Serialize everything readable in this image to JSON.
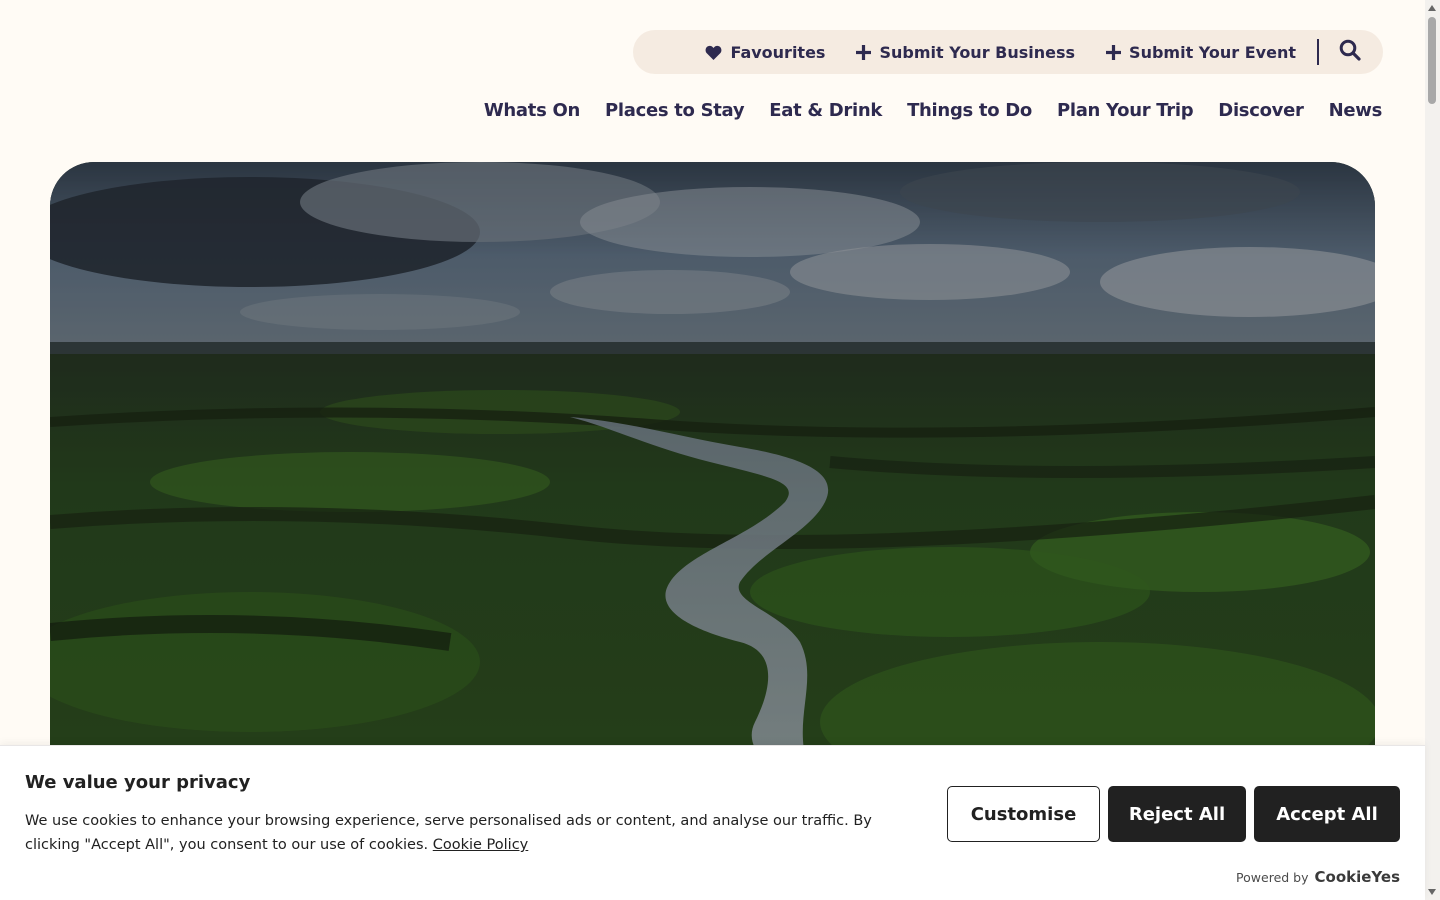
{
  "utility_nav": {
    "favourites": {
      "label": "Favourites",
      "icon": "heart-icon"
    },
    "submit_business": {
      "label": "Submit Your Business",
      "icon": "plus-icon"
    },
    "submit_event": {
      "label": "Submit Your Event",
      "icon": "plus-icon"
    },
    "search": {
      "icon": "search-icon"
    }
  },
  "main_nav": {
    "items": [
      {
        "label": "Whats On"
      },
      {
        "label": "Places to Stay"
      },
      {
        "label": "Eat & Drink"
      },
      {
        "label": "Things to Do"
      },
      {
        "label": "Plan Your Trip"
      },
      {
        "label": "Discover"
      },
      {
        "label": "News"
      }
    ]
  },
  "hero": {
    "image_subject": "aerial-river-landscape"
  },
  "cookie_banner": {
    "title": "We value your privacy",
    "body": "We use cookies to enhance your browsing experience, serve personalised ads or content, and analyse our traffic. By clicking \"Accept All\", you consent to our use of cookies.",
    "policy_link": "Cookie Policy",
    "buttons": {
      "customise": "Customise",
      "reject": "Reject All",
      "accept": "Accept All"
    },
    "powered_by": "Powered by",
    "brand": "CookieYes"
  },
  "colors": {
    "page_bg": "#fffbf5",
    "nav_text": "#2e2a4f",
    "utility_bar_bg": "#f5ebe1",
    "button_dark": "#212121"
  }
}
